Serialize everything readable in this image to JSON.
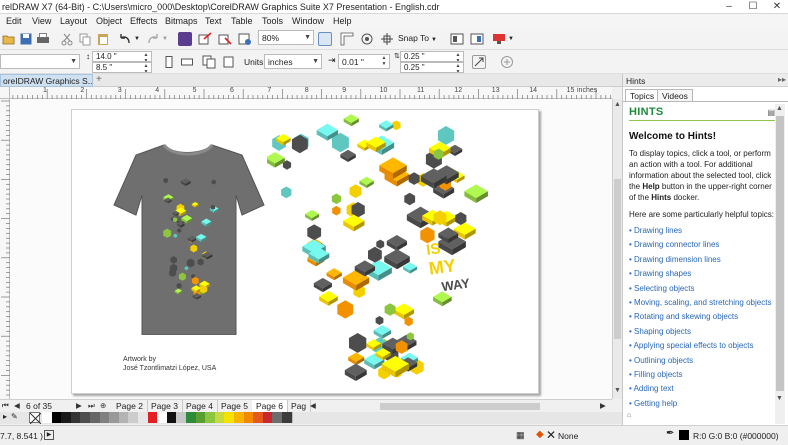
{
  "app": {
    "title": "relDRAW X7 (64-Bit) - C:\\Users\\micro_000\\Desktop\\CorelDRAW Graphics Suite X7 Presentation - English.cdr"
  },
  "menu": [
    "Edit",
    "View",
    "Layout",
    "Object",
    "Effects",
    "Bitmaps",
    "Text",
    "Table",
    "Tools",
    "Window",
    "Help"
  ],
  "toolbar": {
    "zoom": "80%",
    "snap_to": "Snap To"
  },
  "property_bar": {
    "width": "14.0 \"",
    "height": "8.5 \"",
    "units_label": "Units:",
    "units_value": "inches",
    "nudge": "0.01 \"",
    "dup_x": "0.25 \"",
    "dup_y": "0.25 \""
  },
  "document_tab": {
    "label": "oreIDRAW Graphics S..."
  },
  "ruler": {
    "unit": "inches",
    "numbers": [
      "1",
      "2",
      "3",
      "4",
      "5",
      "6",
      "7",
      "8",
      "9",
      "10",
      "11",
      "12",
      "13",
      "14",
      "15"
    ]
  },
  "artwork": {
    "credit_line1": "Artwork by",
    "credit_line2": "José Tzontlimatzi López, USA",
    "lettering": "IS MY WAY"
  },
  "page_nav": {
    "counter": "6 of 35",
    "pages": [
      "Page 2",
      "Page 3",
      "Page 4",
      "Page 5",
      "Page 6",
      "Pag"
    ],
    "active": "Page 6"
  },
  "palette": {
    "colors": [
      "#ffffff",
      "#000000",
      "#1a1a1a",
      "#333333",
      "#4d4d4d",
      "#666666",
      "#808080",
      "#999999",
      "#b3b3b3",
      "#cccccc",
      "#e6e6e6",
      "#e31e24",
      "#ffffff",
      "#111111",
      "#c7c7c7",
      "#2e8b3a",
      "#5a9e2f",
      "#8cc63f",
      "#c6d93e",
      "#f4e300",
      "#f7b500",
      "#f18a00",
      "#e45a1e",
      "#c8282e",
      "#6d6d6d",
      "#3b3b3b"
    ]
  },
  "status": {
    "coords": "7.7, 8.541 )",
    "fill_label": "None",
    "outline_color": "R:0 G:0 B:0 (#000000)"
  },
  "docker": {
    "title": "Hints",
    "tabs": [
      "Topics",
      "Videos"
    ],
    "heading": "HINTS",
    "welcome": "Welcome to Hints!",
    "intro_a": "To display topics, click a tool, or perform an action with a tool. For additional information about the selected tool, click the ",
    "intro_help": "Help",
    "intro_b": " button in the upper-right corner of the ",
    "intro_hints": "Hints",
    "intro_c": " docker.",
    "helpful": "Here are some particularly helpful topics:",
    "links": [
      "Drawing lines",
      "Drawing connector lines",
      "Drawing dimension lines",
      "Drawing shapes",
      "Selecting objects",
      "Moving, scaling, and stretching objects",
      "Rotating and skewing objects",
      "Shaping objects",
      "Applying special effects to objects",
      "Outlining objects",
      "Filling objects",
      "Adding text",
      "Getting help"
    ]
  },
  "colors": {
    "hint_green": "#1f8a3b",
    "link_blue": "#2867b8",
    "cube_dark": "#4d4d4d",
    "cube_yellow": "#f5d000",
    "cube_orange": "#f39200",
    "cube_teal": "#5fc7c0",
    "cube_green": "#8cc63f",
    "shirt": "#6f6f6f"
  }
}
